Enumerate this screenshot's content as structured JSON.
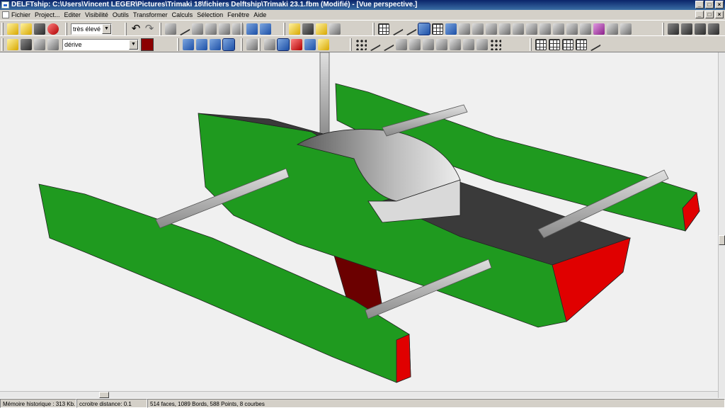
{
  "window": {
    "title": "DELFTship: C:\\Users\\Vincent LEGER\\Pictures\\Trimaki 18\\fichiers Delftship\\Trimaki 23.1.fbm (Modifié) - [Vue  perspective.]",
    "minimize": "_",
    "maximize": "□",
    "close": "×"
  },
  "menu": {
    "items": [
      "Fichier",
      "Project...",
      "Editer",
      "Visibilité",
      "Outils",
      "Transformer",
      "Calculs",
      "Sélection",
      "Fenêtre",
      "Aide"
    ]
  },
  "toolbar": {
    "precision_value": "très élevé",
    "layer_value": "dérive",
    "layer_color": "#8b0000"
  },
  "statusbar": {
    "memory": "Mémoire historique : 313 Kb.",
    "distance": "ccroitre distance: 0.1",
    "stats": "514 faces, 1089 Bords, 588 Points, 8 courbes"
  },
  "colors": {
    "hull_green": "#1f9a1f",
    "deck_dark": "#3a3a3a",
    "transom_red": "#e00000",
    "keel_dark_red": "#6b0000",
    "cabin_gray": "#d9d9d9",
    "beam_gray": "#b8b8b8",
    "background": "#f0f0f0"
  },
  "icons": {
    "file": [
      "new-file-icon",
      "open-folder-icon",
      "save-icon",
      "delftship-logo-icon"
    ],
    "edit": [
      "undo-icon",
      "redo-icon"
    ]
  }
}
